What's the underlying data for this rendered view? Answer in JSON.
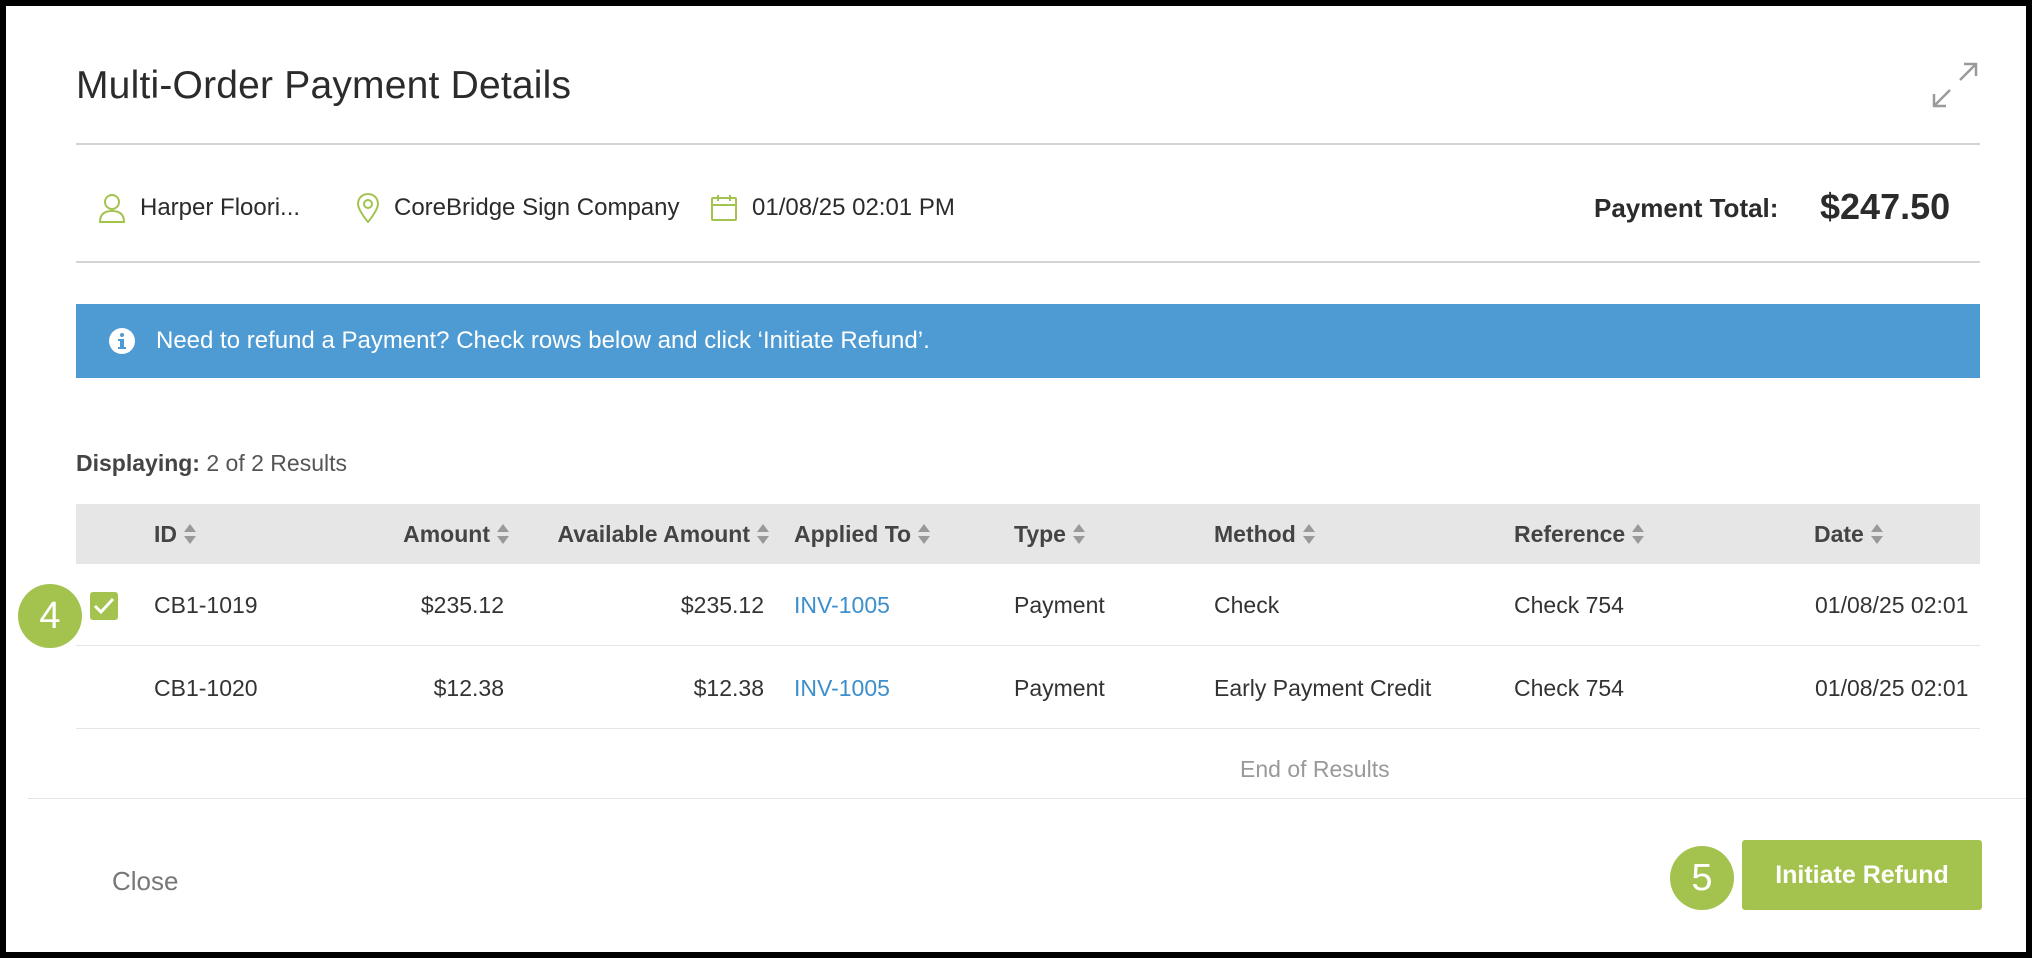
{
  "modal": {
    "title": "Multi-Order Payment Details",
    "expand_icon": "expand-arrows-icon"
  },
  "info": {
    "customer": "Harper Floori...",
    "company": "CoreBridge Sign Company",
    "datetime": "01/08/25 02:01 PM",
    "payment_total_label": "Payment Total:",
    "payment_total_value": "$247.50"
  },
  "banner": {
    "text": "Need to refund a Payment? Check rows below and click ‘Initiate Refund’."
  },
  "results": {
    "label": "Displaying:",
    "value": "2 of 2 Results",
    "end_text": "End of Results"
  },
  "table": {
    "columns": [
      "ID",
      "Amount",
      "Available Amount",
      "Applied To",
      "Type",
      "Method",
      "Reference",
      "Date"
    ],
    "rows": [
      {
        "checked": true,
        "id": "CB1-1019",
        "amount": "$235.12",
        "available": "$235.12",
        "applied_to": "INV-1005",
        "type": "Payment",
        "method": "Check",
        "reference": "Check 754",
        "date": "01/08/25 02:01"
      },
      {
        "checked": false,
        "id": "CB1-1020",
        "amount": "$12.38",
        "available": "$12.38",
        "applied_to": "INV-1005",
        "type": "Payment",
        "method": "Early Payment Credit",
        "reference": "Check 754",
        "date": "01/08/25 02:01"
      }
    ]
  },
  "footer": {
    "close_label": "Close",
    "refund_label": "Initiate Refund"
  },
  "steps": {
    "checkbox_step": "4",
    "refund_step": "5"
  },
  "colors": {
    "accent_green": "#a4c34e",
    "banner_blue": "#4e9bd4",
    "link_blue": "#3d8fcc"
  }
}
